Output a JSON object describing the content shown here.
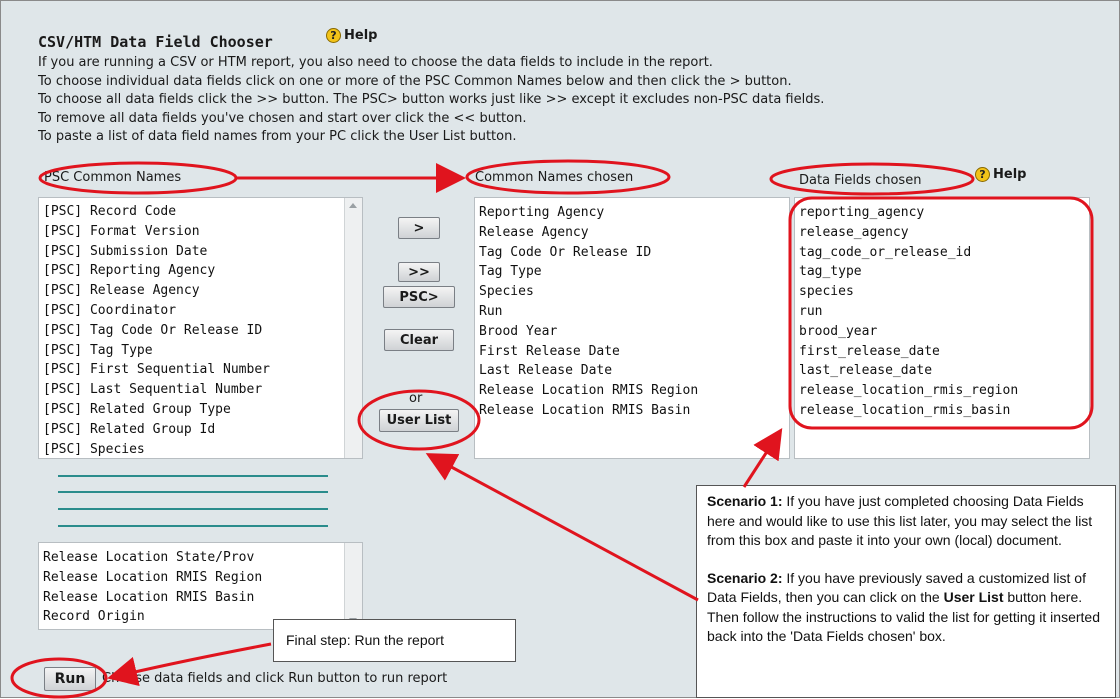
{
  "title": "CSV/HTM Data Field Chooser",
  "help_label": "Help",
  "instructions": [
    "If you are running a CSV or HTM report, you also need to choose the data fields to include in the report.",
    "To choose individual data fields click on one or more of the PSC Common Names below and then click the > button.",
    "To choose all data fields click the >> button. The PSC> button works just like >> except it excludes non-PSC data fields.",
    "To remove all data fields you've chosen and start over click the << button.",
    "To paste a list of data field names from your PC click the User List button."
  ],
  "columns": {
    "psc": "PSC Common Names",
    "chosen": "Common Names chosen",
    "fields": "Data Fields chosen"
  },
  "psc_list_top": [
    "[PSC] Record Code",
    "[PSC] Format Version",
    "[PSC] Submission Date",
    "[PSC] Reporting Agency",
    "[PSC] Release Agency",
    "[PSC] Coordinator",
    "[PSC] Tag Code Or Release ID",
    "[PSC] Tag Type",
    "[PSC] First Sequential Number",
    "[PSC] Last Sequential Number",
    "[PSC] Related Group Type",
    "[PSC] Related Group Id",
    "[PSC] Species"
  ],
  "psc_list_bottom": [
    "Release Location State/Prov",
    "Release Location RMIS Region",
    "Release Location RMIS Basin",
    "Record Origin"
  ],
  "buttons": {
    "add": ">",
    "add_all": ">>",
    "psc": "PSC>",
    "clear": "Clear",
    "or": "or",
    "user_list": "User List",
    "run": "Run"
  },
  "chosen_list": [
    "Reporting Agency",
    "Release Agency",
    "Tag Code Or Release ID",
    "Tag Type",
    "Species",
    "Run",
    "Brood Year",
    "First Release Date",
    "Last Release Date",
    "Release Location RMIS Region",
    "Release Location RMIS Basin"
  ],
  "fields_list": [
    "reporting_agency",
    "release_agency",
    "tag_code_or_release_id",
    "tag_type",
    "species",
    "run",
    "brood_year",
    "first_release_date",
    "last_release_date",
    "release_location_rmis_region",
    "release_location_rmis_basin"
  ],
  "run_hint": "Choose data fields and click Run button to run report",
  "final_step": "Final step:  Run the report",
  "scenario1": {
    "label": "Scenario 1:",
    "text": " If you have just completed choosing Data Fields here and would like to use this list later, you may select the list from this box and paste it into your own (local) document."
  },
  "scenario2": {
    "label": "Scenario 2:",
    "text_a": "  If you have previously saved a customized list of Data Fields, then you can click on the ",
    "bold": "User List",
    "text_b": " button here.  Then follow the instructions to valid the list for getting it inserted back into the 'Data Fields chosen' box."
  },
  "colors": {
    "annotation": "#e0141e",
    "panel": "#dfe6e9",
    "teal": "#2a8c8c"
  }
}
